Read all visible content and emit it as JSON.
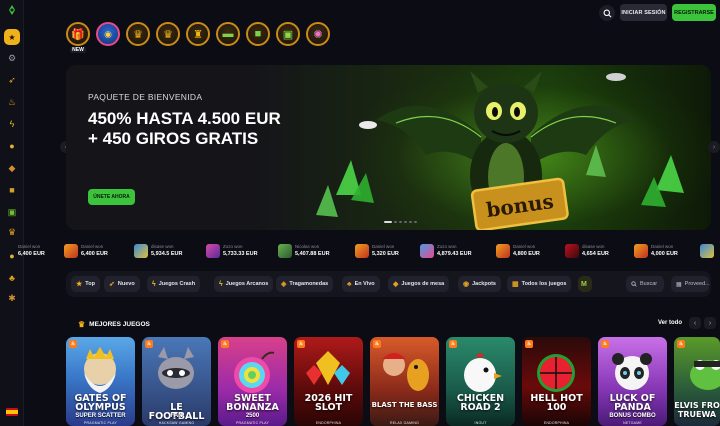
{
  "brand": {
    "accent": "#3bc43b",
    "gold": "#f0b21a"
  },
  "header": {
    "login_label": "INICIAR SESIÓN",
    "register_label": "REGISTRARSE",
    "search_icon": "search-icon",
    "top_categories": [
      {
        "icon": "treasure-chest-icon",
        "badge": "NEW"
      },
      {
        "icon": "promo-chip-icon",
        "badge": ""
      },
      {
        "icon": "crown-icon",
        "badge": ""
      },
      {
        "icon": "crown-icon",
        "badge": ""
      },
      {
        "icon": "trophy-icon",
        "badge": ""
      },
      {
        "icon": "cash-icon",
        "badge": ""
      },
      {
        "icon": "gift-icon",
        "badge": ""
      },
      {
        "icon": "gift-icon",
        "badge": ""
      },
      {
        "icon": "wheel-icon",
        "badge": ""
      }
    ]
  },
  "sidebar": {
    "items": [
      "star-icon",
      "gear-icon",
      "rocket-icon",
      "fire-icon",
      "lightning-icon",
      "coins-icon",
      "dice-icon",
      "gift-icon",
      "gift-box-icon",
      "crown-icon",
      "coin-icon",
      "cards-icon",
      "chip-icon"
    ]
  },
  "hero": {
    "subtitle": "PAQUETE DE BIENVENIDA",
    "title": "450% HASTA 4.500 EUR + 450 GIROS GRATIS",
    "cta_label": "ÚNETE AHORA",
    "art_label": "bonus"
  },
  "ticker": [
    {
      "user": "Daniel won",
      "amount": "6,400 EUR"
    },
    {
      "user": "Daniel won",
      "amount": "6,400 EUR"
    },
    {
      "user": "disase won",
      "amount": "5,934.5 EUR"
    },
    {
      "user": "Zozo won",
      "amount": "5,733.33 EUR"
    },
    {
      "user": "Nicolas won",
      "amount": "5,407.88 EUR"
    },
    {
      "user": "Daniel won",
      "amount": "5,320 EUR"
    },
    {
      "user": "Zozo won",
      "amount": "4,879.43 EUR"
    },
    {
      "user": "Daniel won",
      "amount": "4,800 EUR"
    },
    {
      "user": "disase won",
      "amount": "4,654 EUR"
    },
    {
      "user": "Daniel won",
      "amount": "4,000 EUR"
    }
  ],
  "filters": {
    "chips": [
      {
        "label": "Top",
        "icon": "star-icon"
      },
      {
        "label": "Nuevo",
        "icon": "rocket-icon"
      },
      {
        "label": "Juegos Crash",
        "icon": "lightning-icon"
      },
      {
        "label": "Juegos Arcanos",
        "icon": "lightning-icon"
      },
      {
        "label": "Tragamonedas",
        "icon": "slots-icon"
      },
      {
        "label": "En Vivo",
        "icon": "cards-icon"
      },
      {
        "label": "Juegos de mesa",
        "icon": "table-icon"
      },
      {
        "label": "Jackpots",
        "icon": "jackpot-icon"
      },
      {
        "label": "Todos los juegos",
        "icon": "grid-icon"
      }
    ],
    "search_label": "Buscar",
    "provider_label": "Proveed..."
  },
  "games_section": {
    "title": "MEJORES JUEGOS",
    "see_all": "Ver todo",
    "games": [
      {
        "title": "GATES OF OLYMPUS",
        "sub": "SUPER SCATTER",
        "provider": "PRAGMATIC PLAY"
      },
      {
        "title": "LE FOOTBALL",
        "sub": "FAN",
        "provider": "HACKSAW GAMING"
      },
      {
        "title": "SWEET BONANZA",
        "sub": "2500",
        "provider": "PRAGMATIC PLAY"
      },
      {
        "title": "2026 HIT SLOT",
        "sub": "",
        "provider": "ENDORPHINA"
      },
      {
        "title": "BLAST THE BASS",
        "sub": "",
        "provider": "RELAX GAMING"
      },
      {
        "title": "CHICKEN ROAD 2",
        "sub": "",
        "provider": "INOUT"
      },
      {
        "title": "HELL HOT 100",
        "sub": "",
        "provider": "ENDORPHINA"
      },
      {
        "title": "LUCK OF PANDA",
        "sub": "BONUS COMBO",
        "provider": "NETGAME"
      },
      {
        "title": "ELVIS FRO TRUEWA",
        "sub": "",
        "provider": ""
      }
    ]
  }
}
